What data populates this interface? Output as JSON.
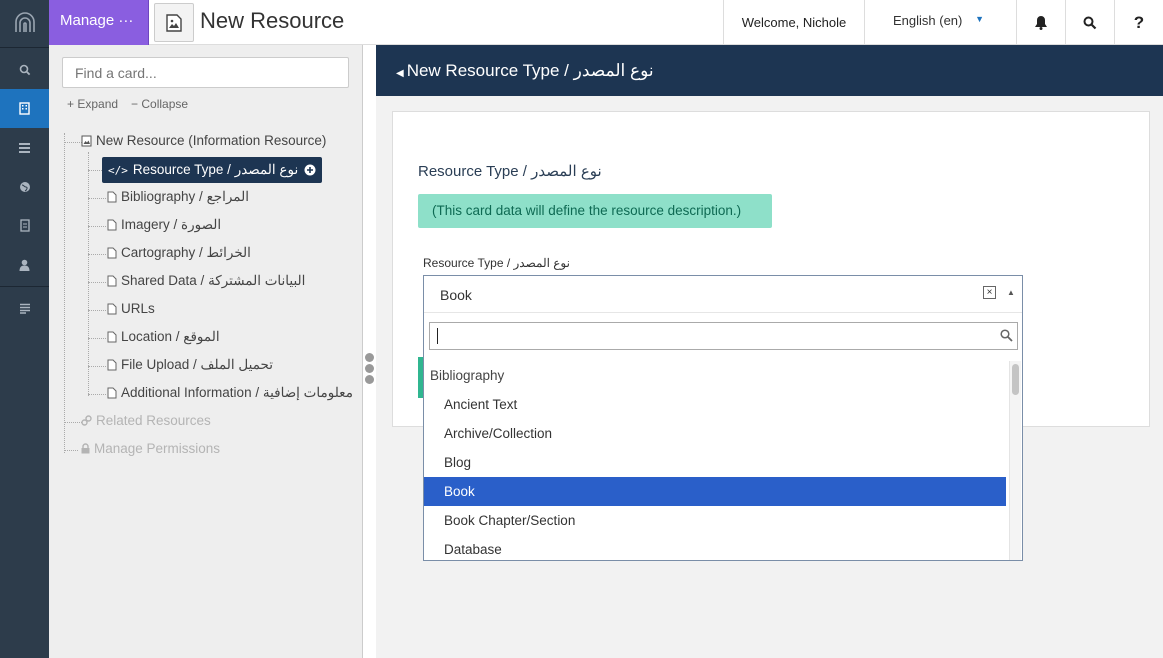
{
  "topbar": {
    "manage_label": "Manage",
    "manage_dots": "···",
    "page_title": "New Resource",
    "welcome": "Welcome, Nichole",
    "language": "English (en)"
  },
  "sidebar_icons": [
    "search-icon",
    "building-icon",
    "stack-icon",
    "globe-icon",
    "clipboard-icon",
    "user-icon",
    "list-icon"
  ],
  "tree": {
    "search_placeholder": "Find a card...",
    "expand_label": "Expand",
    "collapse_label": "Collapse",
    "root": "New Resource (Information Resource)",
    "items": [
      "Resource Type / نوع المصدر",
      "Bibliography / المراجع",
      "Imagery / الصورة",
      "Cartography / الخرائط",
      "Shared Data / البيانات المشتركة",
      "URLs",
      "Location / الموقع",
      "File Upload / تحميل الملف",
      "Additional Information / معلومات إضافية"
    ],
    "related": "Related Resources",
    "permissions": "Manage Permissions"
  },
  "card": {
    "header": "New Resource Type / نوع المصدر",
    "title": "Resource Type / نوع المصدر",
    "info": "(This card data will define the resource description.)",
    "field_label": "Resource Type / نوع المصدر",
    "selected": "Book",
    "clear_symbol": "×",
    "options": [
      {
        "label": "Bibliography",
        "group": true
      },
      {
        "label": "Ancient Text"
      },
      {
        "label": "Archive/Collection"
      },
      {
        "label": "Blog"
      },
      {
        "label": "Book",
        "highlighted": true
      },
      {
        "label": "Book Chapter/Section"
      },
      {
        "label": "Database"
      }
    ]
  },
  "colors": {
    "rail": "#2d3c4b",
    "accent": "#1e73be",
    "manage": "#8a5ee0",
    "header": "#1d3552",
    "info": "#8ee0c9",
    "highlight": "#2a5fc9"
  }
}
